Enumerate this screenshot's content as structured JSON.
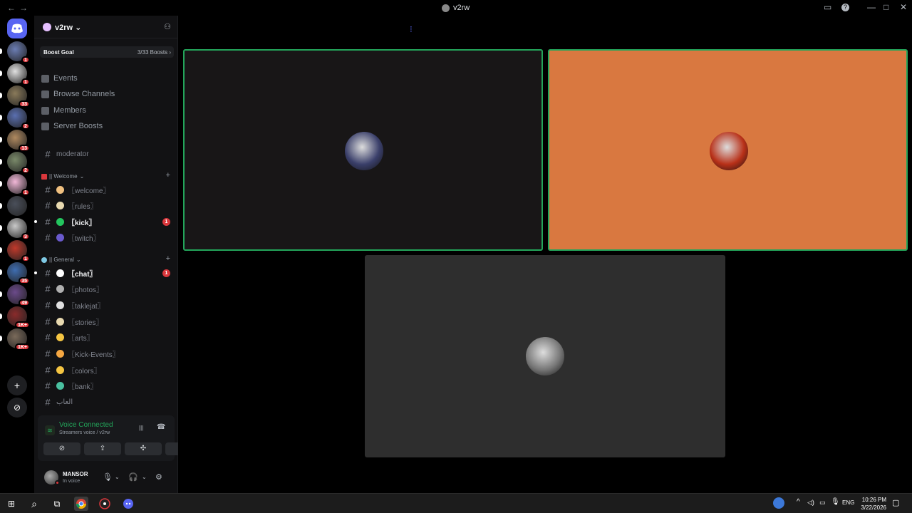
{
  "window": {
    "title": "v2rw",
    "back_icon": "←",
    "forward_icon": "→",
    "inbox_icon": "▭",
    "help_icon": "?",
    "minimize_icon": "—",
    "maximize_icon": "□",
    "close_icon": "✕"
  },
  "rail": {
    "home_icon": "discord-icon",
    "servers": [
      {
        "badge": "1",
        "color": "#6b7db3"
      },
      {
        "badge": "1",
        "color": "#e0e0e0"
      },
      {
        "badge": "33",
        "color": "#8a7a5a"
      },
      {
        "badge": "2",
        "color": "#5a6fb0"
      },
      {
        "badge": "13",
        "color": "#b08a60"
      },
      {
        "badge": "2",
        "color": "#7a8a6a"
      },
      {
        "badge": "1",
        "color": "#f2b8d8"
      },
      {
        "badge": "",
        "color": "#4a4f5a"
      },
      {
        "badge": "3",
        "color": "#c9c9c9"
      },
      {
        "badge": "1",
        "color": "#c0392b"
      },
      {
        "badge": "35",
        "color": "#3f6db0"
      },
      {
        "badge": "49",
        "color": "#6b4a8a"
      },
      {
        "badge": "1K+",
        "color": "#8a2b2b"
      },
      {
        "badge": "1K+",
        "color": "#7a6a5a"
      }
    ],
    "add_icon": "+",
    "discover_icon": "⊘"
  },
  "server": {
    "name": "v2rw",
    "chevron": "⌄",
    "add_user_icon": "⚇",
    "boost_label": "Boost Goal",
    "boost_count": "3/33 Boosts",
    "boost_chevron": "›"
  },
  "nav": [
    {
      "label": "Events"
    },
    {
      "label": "Browse Channels"
    },
    {
      "label": "Members"
    },
    {
      "label": "Server Boosts"
    }
  ],
  "channels_top": [
    {
      "label": "moderator"
    }
  ],
  "category_welcome": {
    "label": "|| Welcome",
    "chevron": "⌄",
    "add": "+"
  },
  "channels_welcome": [
    {
      "label": "〖welcome〗",
      "emoji": "#f0c080",
      "prefix": "👋 ·",
      "unread": false,
      "badge": ""
    },
    {
      "label": "〖rules〗",
      "emoji": "#e8d9b0",
      "prefix": "📜 ·",
      "unread": false,
      "badge": ""
    },
    {
      "label": "〖kick〗",
      "emoji": "#23c55e",
      "prefix": "·",
      "unread": true,
      "badge": "1"
    },
    {
      "label": "〖twitch〗",
      "emoji": "#6a5acd",
      "prefix": "·",
      "unread": false,
      "badge": ""
    }
  ],
  "category_general": {
    "label": "|| General",
    "chevron": "⌄",
    "add": "+"
  },
  "channels_general": [
    {
      "label": "〖chat〗",
      "emoji": "#ffffff",
      "prefix": "·",
      "unread": true,
      "badge": "1"
    },
    {
      "label": "〖photos〗",
      "emoji": "#b0b0b0",
      "prefix": "·",
      "unread": false,
      "badge": ""
    },
    {
      "label": "〖taklejat〗",
      "emoji": "#e0e0e0",
      "prefix": "·",
      "unread": false,
      "badge": ""
    },
    {
      "label": "〖stories〗",
      "emoji": "#e8d9b0",
      "prefix": "·",
      "unread": false,
      "badge": ""
    },
    {
      "label": "〖arts〗",
      "emoji": "#f5c542",
      "prefix": "·",
      "unread": false,
      "badge": ""
    },
    {
      "label": "〖Kick-Events〗",
      "emoji": "#f5a742",
      "prefix": "·",
      "unread": false,
      "badge": ""
    },
    {
      "label": "〖colors〗",
      "emoji": "#f5c542",
      "prefix": "·",
      "unread": false,
      "badge": ""
    },
    {
      "label": "〖bank〗",
      "emoji": "#4ac0a0",
      "prefix": "·",
      "unread": false,
      "badge": ""
    },
    {
      "label": "العاب",
      "emoji": "",
      "prefix": "",
      "unread": false,
      "badge": ""
    }
  ],
  "voice": {
    "status": "Voice Connected",
    "channel": "Streamers voice / v2rw",
    "signal_icon": "≋",
    "noise_icon": "|||",
    "disconnect_icon": "☎",
    "camera_icon": "⊘",
    "screen_icon": "⇪",
    "activity_icon": "✣",
    "soundboard_icon": "♪"
  },
  "user": {
    "name": "MANSOR",
    "status": "In voice",
    "mic_icon": "🎙",
    "headset_icon": "🎧",
    "settings_icon": "⚙",
    "caret": "⌄"
  },
  "stage": {
    "loader": "⁝",
    "tiles": [
      {
        "bg": "#181617",
        "avatar": "#3a3f6a",
        "speaking": true
      },
      {
        "bg": "#d97840",
        "avatar": "#b83018",
        "speaking": true
      },
      {
        "bg": "#2e2e2e",
        "avatar": "#777777",
        "speaking": false
      }
    ],
    "colors": {
      "speaking": "#23a55a"
    }
  },
  "taskbar": {
    "start_icon": "⊞",
    "search_icon": "⌕",
    "taskview_icon": "⧉",
    "apps": [
      "chrome-icon",
      "app-icon",
      "discord-icon"
    ],
    "tray": {
      "chevron": "^",
      "language": "ENG",
      "time": "10:26 PM",
      "date": "3/22/2026"
    }
  }
}
